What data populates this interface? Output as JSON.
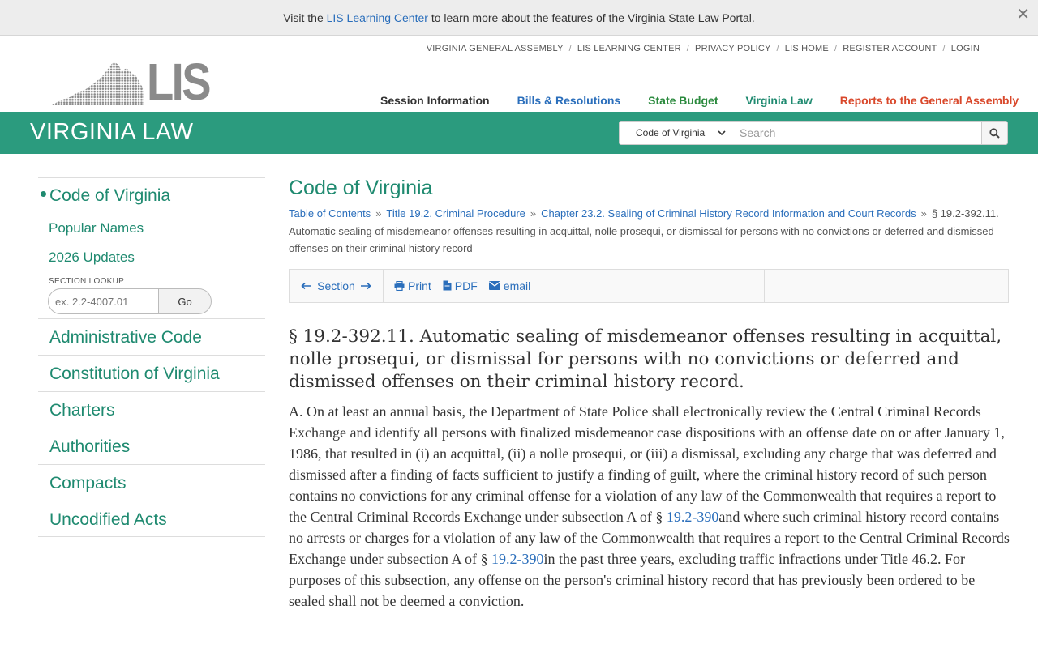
{
  "banner": {
    "prefix": "Visit the ",
    "link": "LIS Learning Center",
    "suffix": " to learn more about the features of the Virginia State Law Portal.",
    "close_glyph": "✕"
  },
  "logo": {
    "text": "LIS"
  },
  "util_links": [
    "VIRGINIA GENERAL ASSEMBLY",
    "LIS LEARNING CENTER",
    "PRIVACY POLICY",
    "LIS HOME",
    "REGISTER ACCOUNT",
    "LOGIN"
  ],
  "main_nav": [
    {
      "label": "Session Information",
      "color": "#333333"
    },
    {
      "label": "Bills & Resolutions",
      "color": "#2a6ebb"
    },
    {
      "label": "State Budget",
      "color": "#2b8a3e"
    },
    {
      "label": "Virginia Law",
      "color": "#1f8a70"
    },
    {
      "label": "Reports to the General Assembly",
      "color": "#d9482b"
    }
  ],
  "greenbar": {
    "title": "VIRGINIA LAW",
    "search_scope": "Code of Virginia",
    "search_placeholder": "Search"
  },
  "sidebar": {
    "primary": "Code of Virginia",
    "sub_items": [
      "Popular Names",
      "2026 Updates"
    ],
    "lookup_label": "SECTION LOOKUP",
    "lookup_placeholder": "ex. 2.2-4007.01",
    "lookup_button": "Go",
    "items": [
      "Administrative Code",
      "Constitution of Virginia",
      "Charters",
      "Authorities",
      "Compacts",
      "Uncodified Acts"
    ]
  },
  "content": {
    "title": "Code of Virginia",
    "breadcrumb": {
      "links": [
        "Table of Contents",
        "Title 19.2. Criminal Procedure",
        "Chapter 23.2. Sealing of Criminal History Record Information and Court Records"
      ],
      "current": "§ 19.2-392.11. Automatic sealing of misdemeanor offenses resulting in acquittal, nolle prosequi, or dismissal for persons with no convictions or deferred and dismissed offenses on their criminal history record",
      "separator": "»"
    },
    "toolbar": {
      "section": "Section",
      "print": "Print",
      "pdf": "PDF",
      "email": "email"
    },
    "heading": "§ 19.2-392.11. Automatic sealing of misdemeanor offenses resulting in acquittal, nolle prosequi, or dismissal for persons with no convictions or deferred and dismissed offenses on their criminal history record.",
    "paragraph": {
      "part1": "A. On at least an annual basis, the Department of State Police shall electronically review the Central Criminal Records Exchange and identify all persons with finalized misdemeanor case dispositions with an offense date on or after January 1, 1986, that resulted in (i) an acquittal, (ii) a nolle prosequi, or (iii) a dismissal, excluding any charge that was deferred and dismissed after a finding of facts sufficient to justify a finding of guilt, where the criminal history record of such person contains no convictions for any criminal offense for a violation of any law of the Commonwealth that requires a report to the Central Criminal Records Exchange under subsection A of § ",
      "ref1": "19.2-390",
      "part2": "and where such criminal history record contains no arrests or charges for a violation of any law of the Commonwealth that requires a report to the Central Criminal Records Exchange under subsection A of § ",
      "ref2": "19.2-390",
      "part3": "in the past three years, excluding traffic infractions under Title 46.2. For purposes of this subsection, any offense on the person's criminal history record that has previously been ordered to be sealed shall not be deemed a conviction."
    }
  }
}
